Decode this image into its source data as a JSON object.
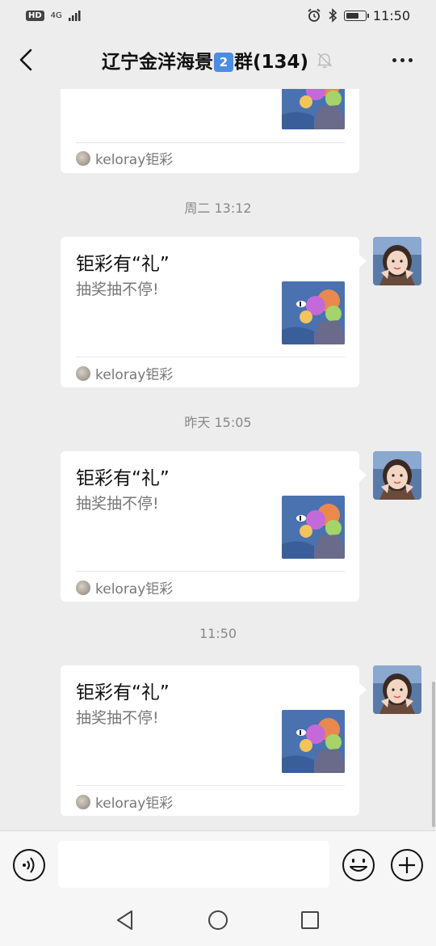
{
  "status_bar": {
    "hd": "HD",
    "signal": "4G",
    "time": "11:50"
  },
  "header": {
    "title": "辽宁金洋海景",
    "group_num": "2",
    "title_suffix": "群(134)"
  },
  "timestamps": [
    "周二 13:12",
    "昨天 15:05",
    "11:50"
  ],
  "cards": [
    {
      "title": "钜彩有“礼”",
      "desc": "抽奖抽不停!",
      "source": "keloray钜彩"
    },
    {
      "title": "钜彩有“礼”",
      "desc": "抽奖抽不停!",
      "source": "keloray钜彩"
    },
    {
      "title": "钜彩有“礼”",
      "desc": "抽奖抽不停!",
      "source": "keloray钜彩"
    }
  ],
  "top_card": {
    "source": "keloray钜彩"
  },
  "colors": {
    "background": "#ededed",
    "card": "#ffffff",
    "muted_text": "#777777",
    "timestamp": "#888888",
    "thumb_bg": "#4a72b0"
  }
}
